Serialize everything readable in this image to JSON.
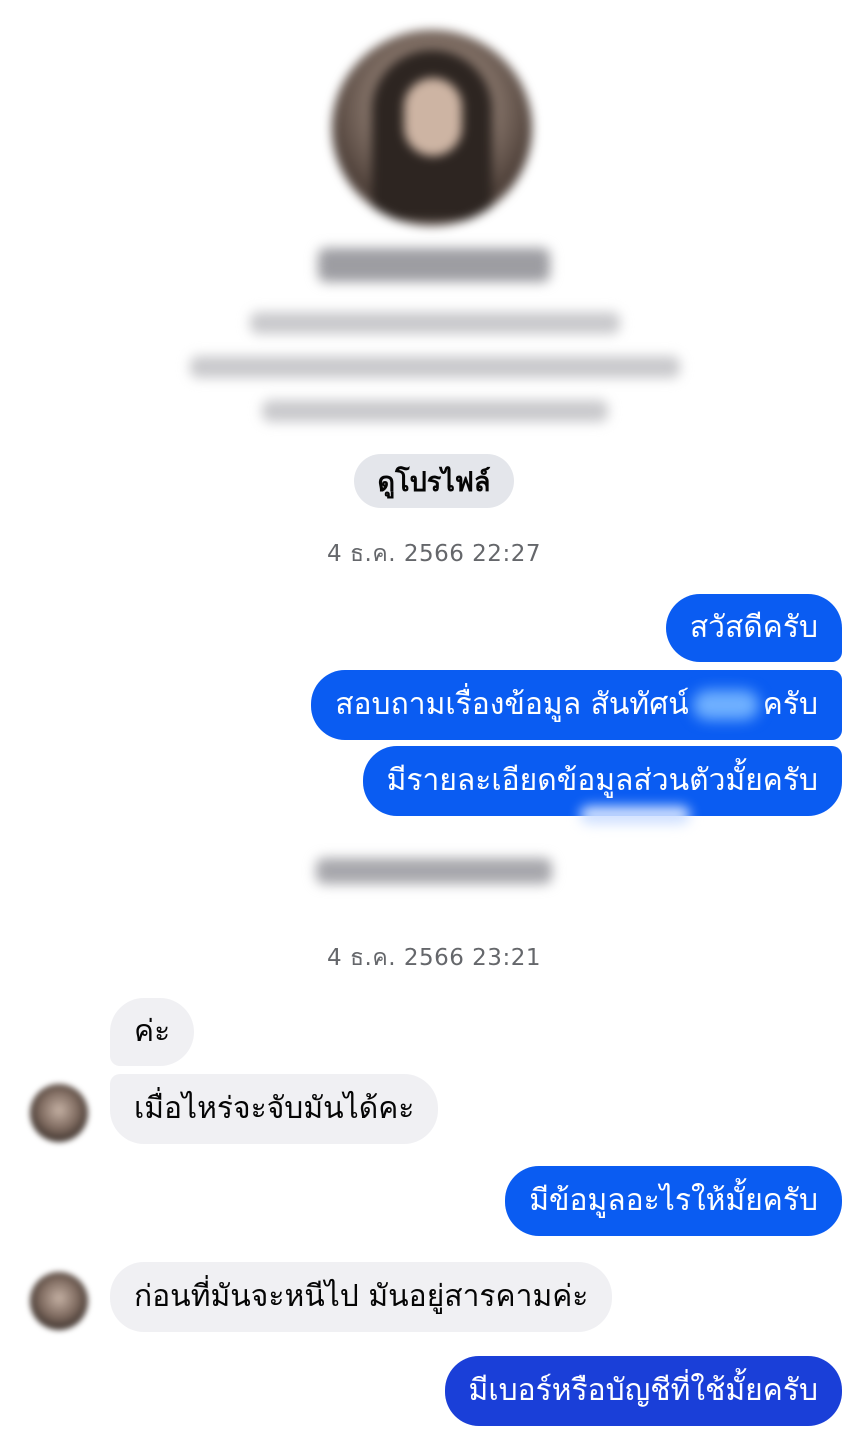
{
  "profile": {
    "view_profile_label": "ดูโปรไฟล์"
  },
  "timestamps": {
    "first": "4 ธ.ค. 2566 22:27",
    "second": "4 ธ.ค. 2566 23:21"
  },
  "messages": [
    {
      "sender": "me",
      "text": "สวัสดีครับ"
    },
    {
      "sender": "me",
      "text_before": "สอบถามเรื่องข้อมูล สันทัศน์",
      "text_after": "ครับ"
    },
    {
      "sender": "me",
      "text": "มีรายละเอียดข้อมูลส่วนตัวมั้ยครับ"
    },
    {
      "sender": "them",
      "text": "ค่ะ"
    },
    {
      "sender": "them",
      "text": "เมื่อไหร่จะจับมันได้คะ"
    },
    {
      "sender": "me",
      "text": "มีข้อมูลอะไรให้มั้ยครับ"
    },
    {
      "sender": "them",
      "text": "ก่อนที่มันจะหนีไป มันอยู่สารคามค่ะ"
    },
    {
      "sender": "me",
      "text": "มีเบอร์หรือบัญชีที่ใช้มั้ยครับ"
    }
  ],
  "colors": {
    "outgoing_bubble": "#0a5cf2",
    "incoming_bubble": "#f0f0f3",
    "timestamp_text": "#65676b"
  },
  "icons": {
    "profile_avatar": "profile-avatar-image",
    "contact_avatar": "contact-avatar-image"
  }
}
